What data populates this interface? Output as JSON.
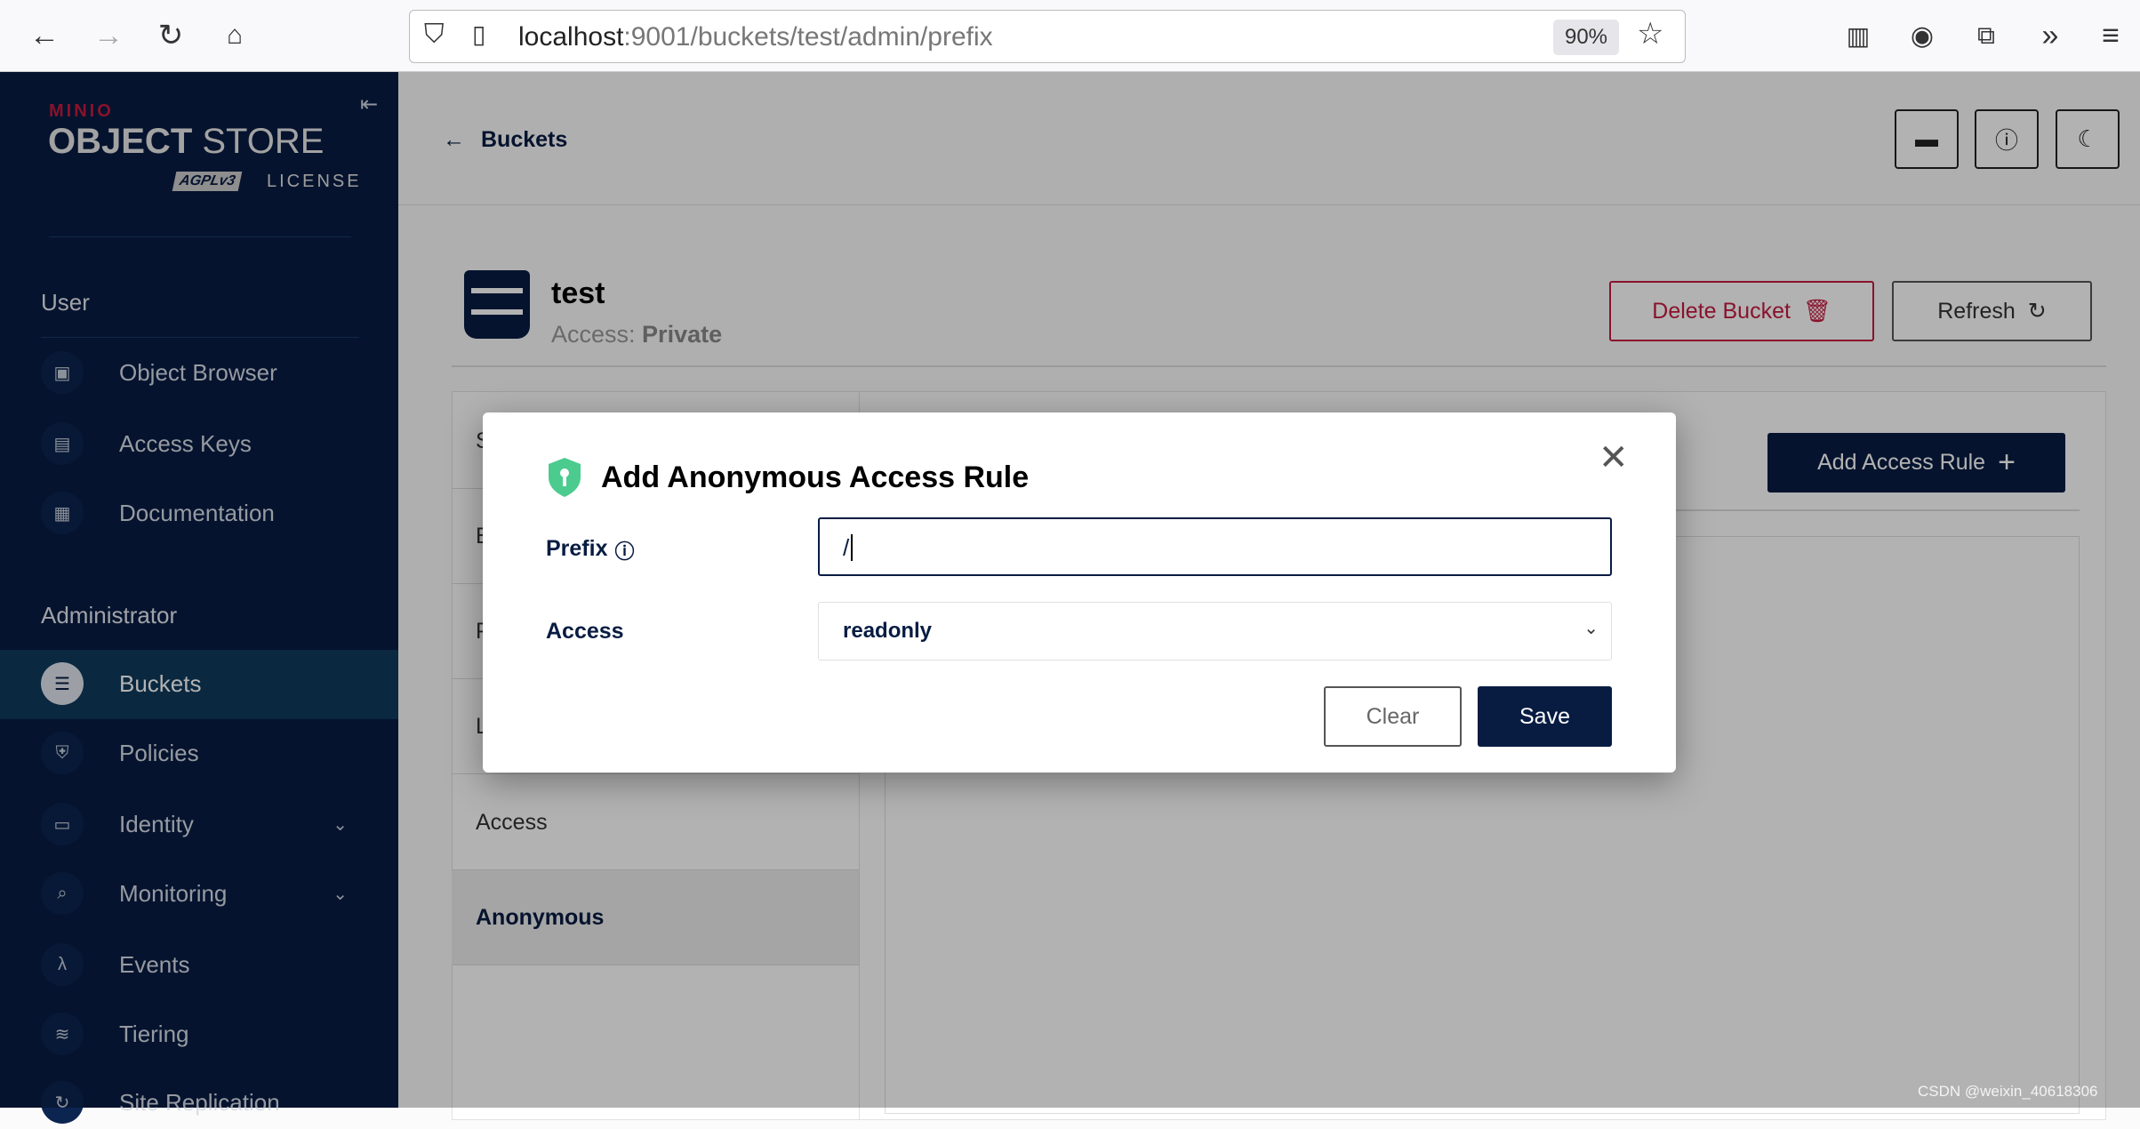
{
  "browser": {
    "url_host": "localhost",
    "url_rest": ":9001/buckets/test/admin/prefix",
    "zoom": "90%"
  },
  "sidebar": {
    "logo": {
      "brand": "MINIO",
      "product_bold": "OBJECT",
      "product_light": "STORE",
      "license": "LICENSE",
      "badge": "AGPLv3"
    },
    "user_section": "User",
    "user_items": [
      {
        "label": "Object Browser",
        "icon": "object-browser-icon"
      },
      {
        "label": "Access Keys",
        "icon": "access-keys-icon"
      },
      {
        "label": "Documentation",
        "icon": "documentation-icon"
      }
    ],
    "admin_section": "Administrator",
    "admin_items": [
      {
        "label": "Buckets",
        "selected": true
      },
      {
        "label": "Policies"
      },
      {
        "label": "Identity",
        "expandable": true
      },
      {
        "label": "Monitoring",
        "expandable": true
      },
      {
        "label": "Events"
      },
      {
        "label": "Tiering"
      },
      {
        "label": "Site Replication"
      }
    ]
  },
  "header": {
    "back_label": "Buckets"
  },
  "bucket": {
    "name": "test",
    "access_label": "Access:",
    "access_value": "Private",
    "delete_label": "Delete Bucket",
    "refresh_label": "Refresh"
  },
  "tabs": [
    "S",
    "B",
    "P",
    "L",
    "Access",
    "Anonymous"
  ],
  "panel": {
    "add_rule_label": "Add Access Rule"
  },
  "modal": {
    "title": "Add Anonymous Access Rule",
    "prefix_label": "Prefix",
    "prefix_value": "/",
    "access_label": "Access",
    "access_value": "readonly",
    "clear_label": "Clear",
    "save_label": "Save"
  },
  "watermark": "CSDN @weixin_40618306",
  "colors": {
    "sidebar": "#081c42",
    "primary": "#081c42",
    "danger": "#c51b3f",
    "shield": "#4ccb8f"
  }
}
